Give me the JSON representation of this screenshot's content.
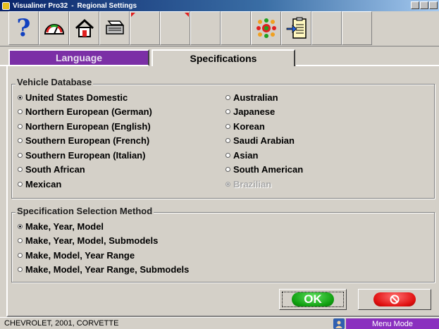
{
  "window": {
    "app_name": "Visualiner Pro32",
    "separator": "-",
    "dialog_title": "Regional Settings"
  },
  "toolbar": {
    "buttons": [
      {
        "icon": "help-icon",
        "glyph": "?"
      },
      {
        "icon": "gauge-icon"
      },
      {
        "icon": "home-icon"
      },
      {
        "icon": "printer-icon"
      },
      {
        "icon": "empty"
      },
      {
        "icon": "empty"
      },
      {
        "icon": "empty"
      },
      {
        "icon": "empty"
      },
      {
        "icon": "target-pattern-icon"
      },
      {
        "icon": "clipboard-import-icon"
      },
      {
        "icon": "empty"
      },
      {
        "icon": "empty"
      }
    ]
  },
  "tabs": [
    {
      "label": "Language",
      "active": false
    },
    {
      "label": "Specifications",
      "active": true
    }
  ],
  "vehicle_database": {
    "title": "Vehicle Database",
    "left_options": [
      {
        "label": "United States Domestic",
        "checked": true,
        "disabled": false
      },
      {
        "label": "Northern European (German)",
        "checked": false,
        "disabled": false
      },
      {
        "label": "Northern European (English)",
        "checked": false,
        "disabled": false
      },
      {
        "label": "Southern European (French)",
        "checked": false,
        "disabled": false
      },
      {
        "label": "Southern European (Italian)",
        "checked": false,
        "disabled": false
      },
      {
        "label": "South African",
        "checked": false,
        "disabled": false
      },
      {
        "label": "Mexican",
        "checked": false,
        "disabled": false
      }
    ],
    "right_options": [
      {
        "label": "Australian",
        "checked": false,
        "disabled": false
      },
      {
        "label": "Japanese",
        "checked": false,
        "disabled": false
      },
      {
        "label": "Korean",
        "checked": false,
        "disabled": false
      },
      {
        "label": "Saudi Arabian",
        "checked": false,
        "disabled": false
      },
      {
        "label": "Asian",
        "checked": false,
        "disabled": false
      },
      {
        "label": "South American",
        "checked": false,
        "disabled": false
      },
      {
        "label": "Brazilian",
        "checked": true,
        "disabled": true
      }
    ]
  },
  "spec_method": {
    "title": "Specification Selection Method",
    "options": [
      {
        "label": "Make, Year, Model",
        "checked": true
      },
      {
        "label": "Make, Year, Model, Submodels",
        "checked": false
      },
      {
        "label": "Make, Model, Year Range",
        "checked": false
      },
      {
        "label": "Make, Model, Year Range, Submodels",
        "checked": false
      }
    ]
  },
  "buttons": {
    "ok_label": "OK",
    "cancel_icon": "cancel-icon"
  },
  "status": {
    "vehicle": "CHEVROLET, 2001, CORVETTE",
    "mode": "Menu Mode"
  },
  "colors": {
    "language_tab": "#7b2fa6",
    "ok": "#10a010",
    "cancel": "#e01010",
    "mode_badge": "#8a2fbf"
  }
}
